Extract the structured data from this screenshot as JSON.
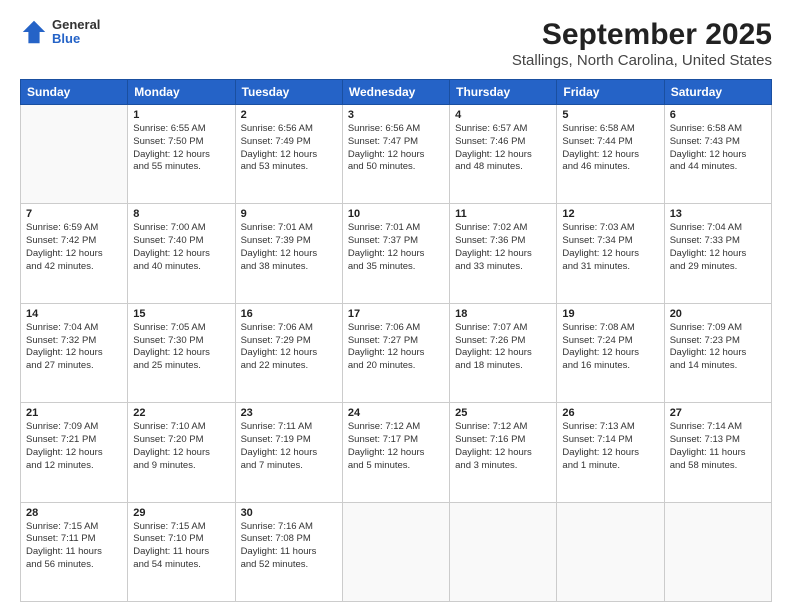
{
  "header": {
    "logo_general": "General",
    "logo_blue": "Blue",
    "month_year": "September 2025",
    "location": "Stallings, North Carolina, United States"
  },
  "weekdays": [
    "Sunday",
    "Monday",
    "Tuesday",
    "Wednesday",
    "Thursday",
    "Friday",
    "Saturday"
  ],
  "weeks": [
    [
      {
        "day": "",
        "info": ""
      },
      {
        "day": "1",
        "info": "Sunrise: 6:55 AM\nSunset: 7:50 PM\nDaylight: 12 hours\nand 55 minutes."
      },
      {
        "day": "2",
        "info": "Sunrise: 6:56 AM\nSunset: 7:49 PM\nDaylight: 12 hours\nand 53 minutes."
      },
      {
        "day": "3",
        "info": "Sunrise: 6:56 AM\nSunset: 7:47 PM\nDaylight: 12 hours\nand 50 minutes."
      },
      {
        "day": "4",
        "info": "Sunrise: 6:57 AM\nSunset: 7:46 PM\nDaylight: 12 hours\nand 48 minutes."
      },
      {
        "day": "5",
        "info": "Sunrise: 6:58 AM\nSunset: 7:44 PM\nDaylight: 12 hours\nand 46 minutes."
      },
      {
        "day": "6",
        "info": "Sunrise: 6:58 AM\nSunset: 7:43 PM\nDaylight: 12 hours\nand 44 minutes."
      }
    ],
    [
      {
        "day": "7",
        "info": "Sunrise: 6:59 AM\nSunset: 7:42 PM\nDaylight: 12 hours\nand 42 minutes."
      },
      {
        "day": "8",
        "info": "Sunrise: 7:00 AM\nSunset: 7:40 PM\nDaylight: 12 hours\nand 40 minutes."
      },
      {
        "day": "9",
        "info": "Sunrise: 7:01 AM\nSunset: 7:39 PM\nDaylight: 12 hours\nand 38 minutes."
      },
      {
        "day": "10",
        "info": "Sunrise: 7:01 AM\nSunset: 7:37 PM\nDaylight: 12 hours\nand 35 minutes."
      },
      {
        "day": "11",
        "info": "Sunrise: 7:02 AM\nSunset: 7:36 PM\nDaylight: 12 hours\nand 33 minutes."
      },
      {
        "day": "12",
        "info": "Sunrise: 7:03 AM\nSunset: 7:34 PM\nDaylight: 12 hours\nand 31 minutes."
      },
      {
        "day": "13",
        "info": "Sunrise: 7:04 AM\nSunset: 7:33 PM\nDaylight: 12 hours\nand 29 minutes."
      }
    ],
    [
      {
        "day": "14",
        "info": "Sunrise: 7:04 AM\nSunset: 7:32 PM\nDaylight: 12 hours\nand 27 minutes."
      },
      {
        "day": "15",
        "info": "Sunrise: 7:05 AM\nSunset: 7:30 PM\nDaylight: 12 hours\nand 25 minutes."
      },
      {
        "day": "16",
        "info": "Sunrise: 7:06 AM\nSunset: 7:29 PM\nDaylight: 12 hours\nand 22 minutes."
      },
      {
        "day": "17",
        "info": "Sunrise: 7:06 AM\nSunset: 7:27 PM\nDaylight: 12 hours\nand 20 minutes."
      },
      {
        "day": "18",
        "info": "Sunrise: 7:07 AM\nSunset: 7:26 PM\nDaylight: 12 hours\nand 18 minutes."
      },
      {
        "day": "19",
        "info": "Sunrise: 7:08 AM\nSunset: 7:24 PM\nDaylight: 12 hours\nand 16 minutes."
      },
      {
        "day": "20",
        "info": "Sunrise: 7:09 AM\nSunset: 7:23 PM\nDaylight: 12 hours\nand 14 minutes."
      }
    ],
    [
      {
        "day": "21",
        "info": "Sunrise: 7:09 AM\nSunset: 7:21 PM\nDaylight: 12 hours\nand 12 minutes."
      },
      {
        "day": "22",
        "info": "Sunrise: 7:10 AM\nSunset: 7:20 PM\nDaylight: 12 hours\nand 9 minutes."
      },
      {
        "day": "23",
        "info": "Sunrise: 7:11 AM\nSunset: 7:19 PM\nDaylight: 12 hours\nand 7 minutes."
      },
      {
        "day": "24",
        "info": "Sunrise: 7:12 AM\nSunset: 7:17 PM\nDaylight: 12 hours\nand 5 minutes."
      },
      {
        "day": "25",
        "info": "Sunrise: 7:12 AM\nSunset: 7:16 PM\nDaylight: 12 hours\nand 3 minutes."
      },
      {
        "day": "26",
        "info": "Sunrise: 7:13 AM\nSunset: 7:14 PM\nDaylight: 12 hours\nand 1 minute."
      },
      {
        "day": "27",
        "info": "Sunrise: 7:14 AM\nSunset: 7:13 PM\nDaylight: 11 hours\nand 58 minutes."
      }
    ],
    [
      {
        "day": "28",
        "info": "Sunrise: 7:15 AM\nSunset: 7:11 PM\nDaylight: 11 hours\nand 56 minutes."
      },
      {
        "day": "29",
        "info": "Sunrise: 7:15 AM\nSunset: 7:10 PM\nDaylight: 11 hours\nand 54 minutes."
      },
      {
        "day": "30",
        "info": "Sunrise: 7:16 AM\nSunset: 7:08 PM\nDaylight: 11 hours\nand 52 minutes."
      },
      {
        "day": "",
        "info": ""
      },
      {
        "day": "",
        "info": ""
      },
      {
        "day": "",
        "info": ""
      },
      {
        "day": "",
        "info": ""
      }
    ]
  ]
}
